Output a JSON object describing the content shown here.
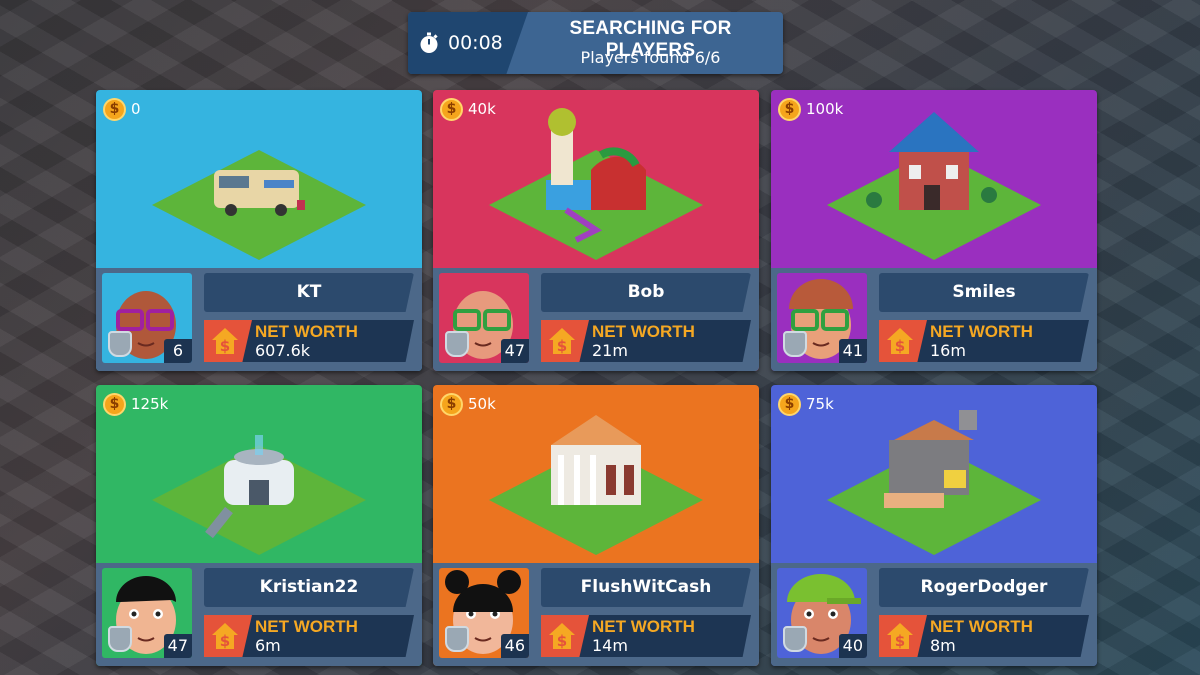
{
  "header": {
    "timer": "00:08",
    "title": "SEARCHING FOR PLAYERS",
    "subtitle": "Players found 6/6",
    "timer_icon": "stopwatch-icon"
  },
  "net_worth_label": "NET WORTH",
  "coin_symbol": "$",
  "players": [
    {
      "name": "KT",
      "coins": "0",
      "level": "6",
      "net_worth": "607.6k",
      "color": "#35b4e0",
      "building": "camper-van",
      "skin": "#b0583a",
      "accessory": "purple-glasses"
    },
    {
      "name": "Bob",
      "coins": "40k",
      "level": "47",
      "net_worth": "21m",
      "color": "#d8355d",
      "building": "bouncy-castle",
      "skin": "#e79a7d",
      "accessory": "green-glasses"
    },
    {
      "name": "Smiles",
      "coins": "100k",
      "level": "41",
      "net_worth": "16m",
      "color": "#9a2fbf",
      "building": "brick-house",
      "skin": "#e8a07a",
      "accessory": "green-glasses-beanie"
    },
    {
      "name": "Kristian22",
      "coins": "125k",
      "level": "47",
      "net_worth": "6m",
      "color": "#30b764",
      "building": "tech-pod",
      "skin": "#f0b592",
      "accessory": "black-hair"
    },
    {
      "name": "FlushWitCash",
      "coins": "50k",
      "level": "46",
      "net_worth": "14m",
      "color": "#eb7420",
      "building": "bank",
      "skin": "#f1b79a",
      "accessory": "black-buns"
    },
    {
      "name": "RogerDodger",
      "coins": "75k",
      "level": "40",
      "net_worth": "8m",
      "color": "#4e63d8",
      "building": "stone-tower",
      "skin": "#d9866a",
      "accessory": "green-cap"
    }
  ]
}
